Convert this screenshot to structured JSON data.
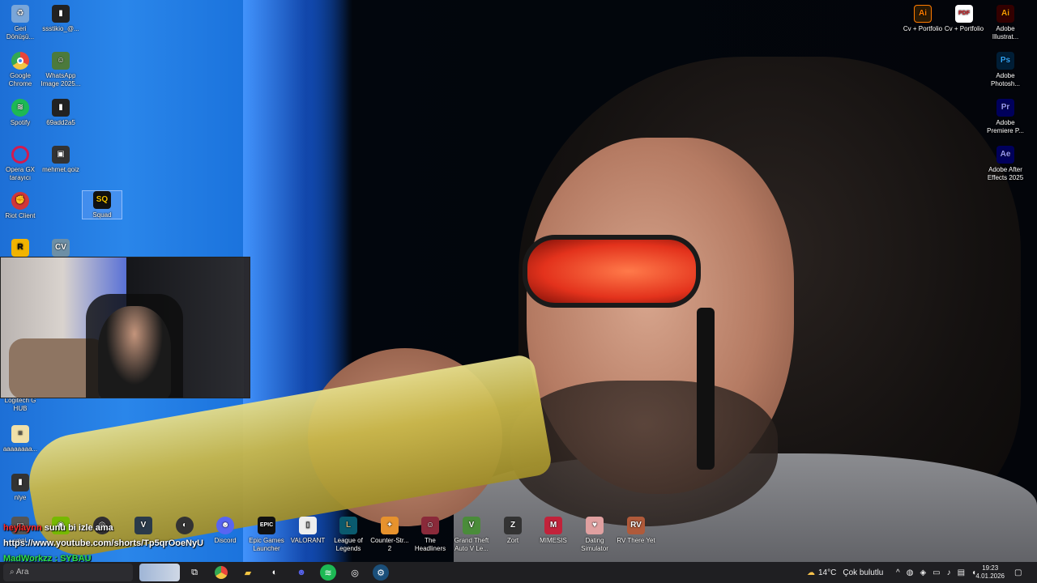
{
  "desktop_icons_left": [
    {
      "id": "recycle-bin",
      "label": "Geri Dönüşü...",
      "icon": "recycle-bin-icon",
      "color": "#7aa6d8"
    },
    {
      "id": "ssstik",
      "label": "ssstikio_@...",
      "icon": "video-file-icon",
      "color": "#222"
    },
    {
      "id": "chrome",
      "label": "Google Chrome",
      "icon": "chrome-icon",
      "color": "#e8453c"
    },
    {
      "id": "whatsapp-image",
      "label": "WhatsApp Image 2025...",
      "icon": "image-file-icon",
      "color": "#4c7a3c"
    },
    {
      "id": "spotify",
      "label": "Spotify",
      "icon": "spotify-icon",
      "color": "#1db954"
    },
    {
      "id": "file-69add",
      "label": "69add2a5",
      "icon": "video-file-icon",
      "color": "#222"
    },
    {
      "id": "opera-gx",
      "label": "Opera GX tarayıcı",
      "icon": "opera-gx-icon",
      "color": "#d21a4f"
    },
    {
      "id": "mehmet-qoiz",
      "label": "mehmet.qoiz",
      "icon": "image-file-icon",
      "color": "#333"
    },
    {
      "id": "riot-client",
      "label": "Riot Client",
      "icon": "riot-client-icon",
      "color": "#d13639"
    },
    {
      "id": "squad",
      "label": "Squad",
      "icon": "squad-icon",
      "color": "#111"
    },
    {
      "id": "rockstar",
      "label": "",
      "icon": "rockstar-icon",
      "color": "#f2b400"
    },
    {
      "id": "cv",
      "label": "",
      "icon": "cv-icon",
      "color": "#6d8fa6"
    },
    {
      "id": "logitech",
      "label": "Logitech G HUB",
      "icon": "logitech-icon",
      "color": "#00b8fc"
    },
    {
      "id": "file-aaaa",
      "label": "aaaaaaaa...",
      "icon": "text-file-icon",
      "color": "#f0e0a8"
    },
    {
      "id": "nlye",
      "label": "nlye",
      "icon": "video-file-icon",
      "color": "#333"
    }
  ],
  "desktop_icons_right": [
    {
      "id": "cv-portfolio-ai",
      "label": "Cv + Portfolio",
      "icon": "illustrator-file-icon",
      "color": "#ff7c00"
    },
    {
      "id": "cv-portfolio-pdf",
      "label": "Cv + Portfolio",
      "icon": "pdf-file-icon",
      "color": "#d9262c"
    },
    {
      "id": "adobe-illustrator",
      "label": "Adobe Illustrat...",
      "icon": "illustrator-icon",
      "color": "#ff9a00"
    },
    {
      "id": "adobe-photoshop",
      "label": "Adobe Photosh...",
      "icon": "photoshop-icon",
      "color": "#31a8ff"
    },
    {
      "id": "adobe-premiere",
      "label": "Adobe Premiere P...",
      "icon": "premiere-icon",
      "color": "#9999ff"
    },
    {
      "id": "adobe-after-effects",
      "label": "Adobe After Effects 2025",
      "icon": "after-effects-icon",
      "color": "#9999ff"
    }
  ],
  "desktop_icons_bottom": [
    {
      "id": "yeni",
      "label": "yeni",
      "icon": "folder-icon",
      "color": "#555"
    },
    {
      "id": "nvidia",
      "label": "",
      "icon": "nvidia-icon",
      "color": "#76b900"
    },
    {
      "id": "obs",
      "label": "",
      "icon": "obs-icon",
      "color": "#302e31"
    },
    {
      "id": "vegas",
      "label": "",
      "icon": "vegas-icon",
      "color": "#2a3a4a"
    },
    {
      "id": "steam-game",
      "label": "",
      "icon": "game-icon",
      "color": "#333"
    },
    {
      "id": "discord",
      "label": "Discord",
      "icon": "discord-icon",
      "color": "#5865f2"
    },
    {
      "id": "epic",
      "label": "Epic Games Launcher",
      "icon": "epic-games-icon",
      "color": "#111"
    },
    {
      "id": "valorant",
      "label": "VALORANT",
      "icon": "valorant-icon",
      "color": "#eee"
    },
    {
      "id": "lol",
      "label": "League of Legends",
      "icon": "league-icon",
      "color": "#0a5a6e"
    },
    {
      "id": "cs2",
      "label": "Counter-Str... 2",
      "icon": "counter-strike-icon",
      "color": "#e7922d"
    },
    {
      "id": "headliners",
      "label": "The Headliners",
      "icon": "headliners-icon",
      "color": "#8a2a3a"
    },
    {
      "id": "gta5",
      "label": "Grand Theft Auto V Le...",
      "icon": "gta-icon",
      "color": "#4a8c3a"
    },
    {
      "id": "zort",
      "label": "Zort",
      "icon": "zort-icon",
      "color": "#333"
    },
    {
      "id": "mimesis",
      "label": "MIMESIS",
      "icon": "mimesis-icon",
      "color": "#c2223a"
    },
    {
      "id": "dating-sim",
      "label": "Dating Simulator",
      "icon": "dating-sim-icon",
      "color": "#e0a0a0"
    },
    {
      "id": "rv-there-yet",
      "label": "RV There Yet",
      "icon": "rv-icon",
      "color": "#b05a3a"
    }
  ],
  "chat": [
    {
      "user": "heylaynn",
      "message": "sunu bi izle ama",
      "user_color": "#ff2a2a"
    },
    {
      "user": "",
      "message": "https://www.youtube.com/shorts/Tp5qrOoeNyU",
      "user_color": "#ffffff"
    },
    {
      "user": "MadWorkzz",
      "message": ": SYBAU",
      "user_color": "#2ee04a"
    },
    {
      "user": "heylaynn",
      "message": "",
      "user_color": "#ff2a2a"
    }
  ],
  "taskbar": {
    "search_placeholder": "Ara",
    "apps": [
      {
        "id": "task-view",
        "icon": "task-view-icon",
        "color": "#2c2c30"
      },
      {
        "id": "chrome",
        "icon": "chrome-icon",
        "color": "#e8453c"
      },
      {
        "id": "file-explorer",
        "icon": "folder-icon",
        "color": "#f4c542"
      },
      {
        "id": "steam-tb",
        "icon": "game-icon",
        "color": "#555"
      },
      {
        "id": "discord-tb",
        "icon": "discord-icon",
        "color": "#5865f2"
      },
      {
        "id": "spotify-tb",
        "icon": "spotify-icon",
        "color": "#1db954"
      },
      {
        "id": "obs-tb",
        "icon": "obs-icon",
        "color": "#302e31"
      },
      {
        "id": "steam",
        "icon": "steam-icon",
        "color": "#1b4f7a"
      }
    ],
    "weather_temp": "14°C",
    "weather_desc": "Çok bulutlu",
    "time": "19:23",
    "date": "4.01.2026"
  }
}
